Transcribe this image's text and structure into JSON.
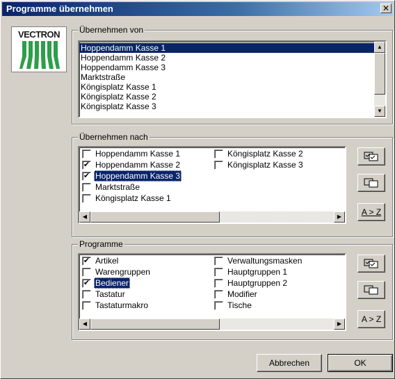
{
  "window": {
    "title": "Programme übernehmen",
    "close_glyph": "✕"
  },
  "logo": {
    "text": "VECTRON"
  },
  "source_group": {
    "label": "Übernehmen von",
    "items": [
      {
        "label": "Hoppendamm Kasse 1",
        "selected": true
      },
      {
        "label": "Hoppendamm Kasse 2",
        "selected": false
      },
      {
        "label": "Hoppendamm Kasse 3",
        "selected": false
      },
      {
        "label": "Marktstraße",
        "selected": false
      },
      {
        "label": "Köngisplatz Kasse 1",
        "selected": false
      },
      {
        "label": "Köngisplatz Kasse 2",
        "selected": false
      },
      {
        "label": "Köngisplatz Kasse 3",
        "selected": false
      }
    ]
  },
  "target_group": {
    "label": "Übernehmen nach",
    "items": [
      {
        "label": "Hoppendamm Kasse 1",
        "checked": false,
        "selected": false
      },
      {
        "label": "Hoppendamm Kasse 2",
        "checked": true,
        "selected": false
      },
      {
        "label": "Hoppendamm Kasse 3",
        "checked": true,
        "selected": true
      },
      {
        "label": "Marktstraße",
        "checked": false,
        "selected": false
      },
      {
        "label": "Köngisplatz Kasse 1",
        "checked": false,
        "selected": false
      },
      {
        "label": "Köngisplatz Kasse 2",
        "checked": false,
        "selected": false
      },
      {
        "label": "Köngisplatz Kasse 3",
        "checked": false,
        "selected": false
      }
    ],
    "sort_label": "A > Z"
  },
  "programs_group": {
    "label": "Programme",
    "items": [
      {
        "label": "Artikel",
        "checked": true,
        "selected": false
      },
      {
        "label": "Warengruppen",
        "checked": false,
        "selected": false
      },
      {
        "label": "Bediener",
        "checked": true,
        "selected": true
      },
      {
        "label": "Tastatur",
        "checked": false,
        "selected": false
      },
      {
        "label": "Tastaturmakro",
        "checked": false,
        "selected": false
      },
      {
        "label": "Verwaltungsmasken",
        "checked": false,
        "selected": false
      },
      {
        "label": "Hauptgruppen 1",
        "checked": false,
        "selected": false
      },
      {
        "label": "Hauptgruppen 2",
        "checked": false,
        "selected": false
      },
      {
        "label": "Modifier",
        "checked": false,
        "selected": false
      },
      {
        "label": "Tische",
        "checked": false,
        "selected": false
      }
    ],
    "sort_label": "A > Z"
  },
  "buttons": {
    "cancel": "Abbrechen",
    "ok": "OK"
  },
  "colors": {
    "face": "#d4d0c8",
    "selection": "#0a246a",
    "logo_green": "#2e9e4a"
  },
  "check_glyph": "✔"
}
